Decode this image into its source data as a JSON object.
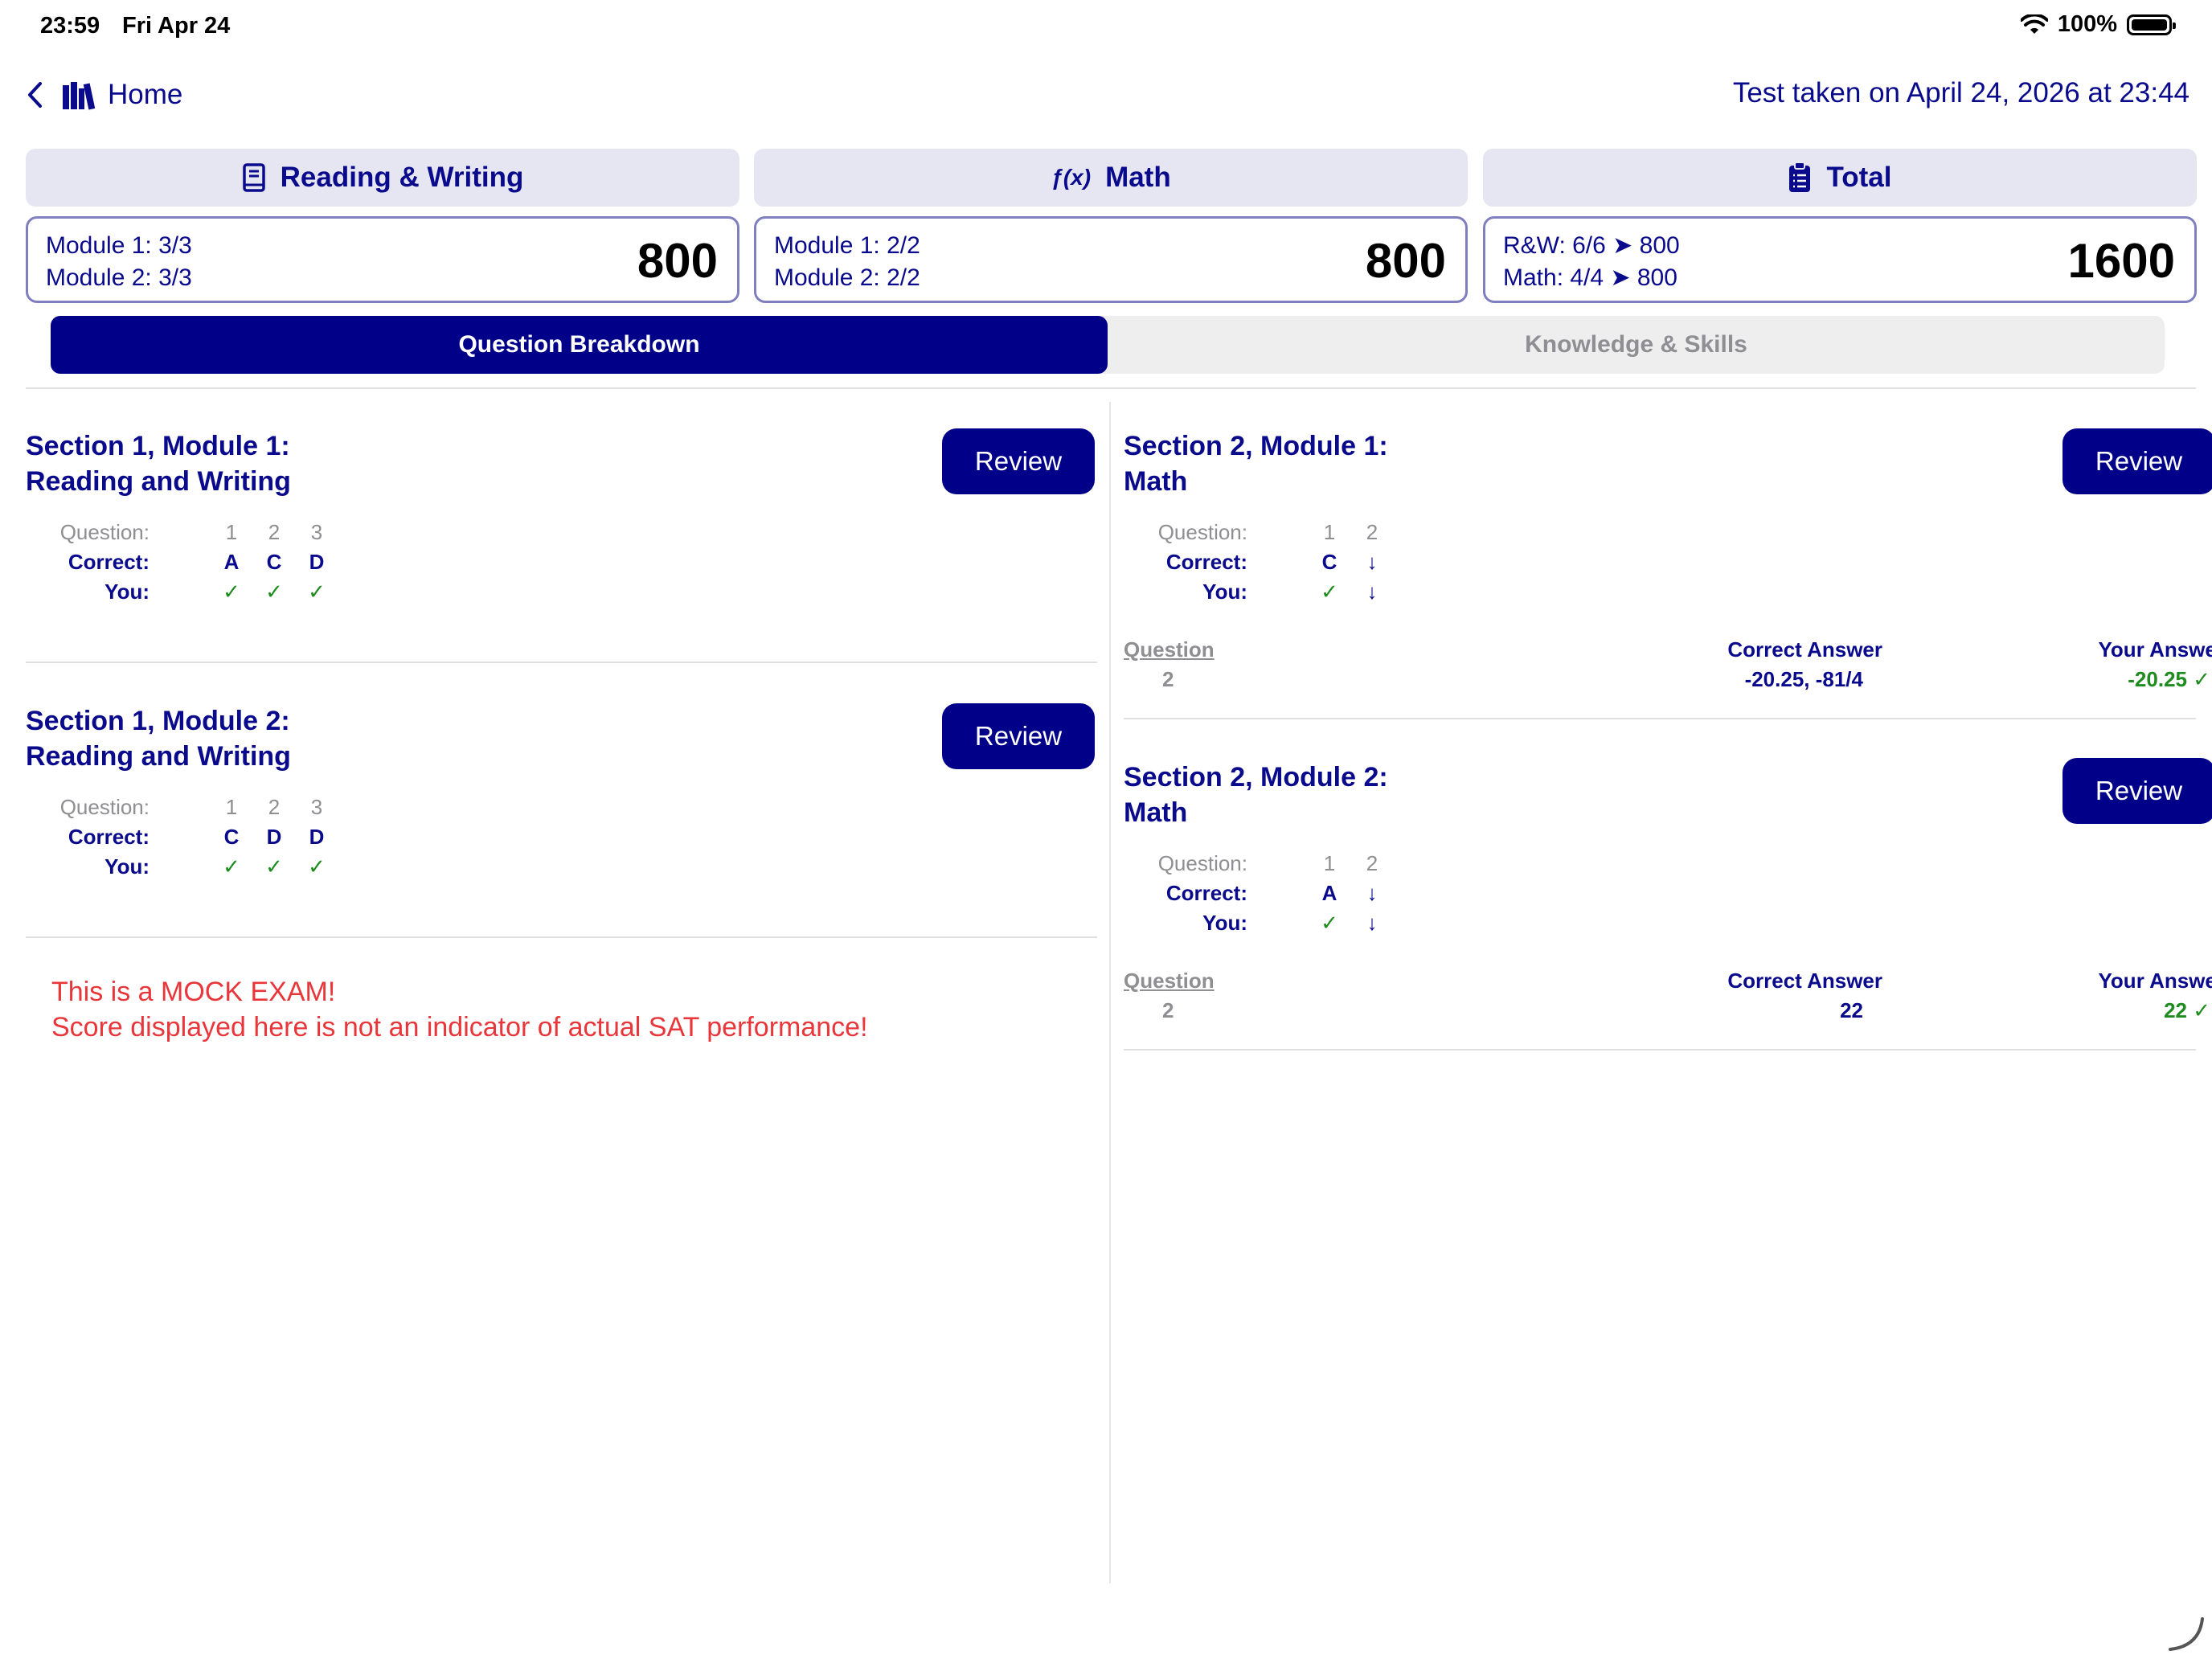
{
  "status": {
    "time": "23:59",
    "date": "Fri Apr 24",
    "battery": "100%"
  },
  "nav": {
    "home_label": "Home",
    "test_taken": "Test taken on April 24, 2026 at 23:44"
  },
  "scores": {
    "rw": {
      "title": "Reading & Writing",
      "line1": "Module 1: 3/3",
      "line2": "Module 2: 3/3",
      "score": "800",
      "icon": "book-icon"
    },
    "math": {
      "title": "Math",
      "icon_text": "ƒ(x)",
      "line1": "Module 1: 2/2",
      "line2": "Module 2: 2/2",
      "score": "800"
    },
    "total": {
      "title": "Total",
      "line1": "R&W: 6/6 ➤ 800",
      "line2": "Math: 4/4 ➤ 800",
      "score": "1600",
      "icon": "clipboard-icon"
    }
  },
  "tabs": {
    "active": "Question Breakdown",
    "inactive": "Knowledge & Skills"
  },
  "labels": {
    "question": "Question:",
    "correct": "Correct:",
    "you": "You:",
    "review": "Review",
    "col_question": "Question",
    "col_correct": "Correct Answer",
    "col_your": "Your Answer"
  },
  "modules": {
    "rw1": {
      "title1": "Section 1, Module 1:",
      "title2": "Reading and Writing",
      "questions": [
        "1",
        "2",
        "3"
      ],
      "correct": [
        "A",
        "C",
        "D"
      ],
      "you": [
        "✓",
        "✓",
        "✓"
      ]
    },
    "rw2": {
      "title1": "Section 1, Module 2:",
      "title2": "Reading and Writing",
      "questions": [
        "1",
        "2",
        "3"
      ],
      "correct": [
        "C",
        "D",
        "D"
      ],
      "you": [
        "✓",
        "✓",
        "✓"
      ]
    },
    "m1": {
      "title1": "Section 2, Module 1:",
      "title2": "Math",
      "questions": [
        "1",
        "2"
      ],
      "correct": [
        "C",
        "↓"
      ],
      "you": [
        "✓",
        "↓"
      ],
      "detail": {
        "question": "2",
        "correct": "-20.25, -81/4",
        "your": "-20.25 ✓"
      }
    },
    "m2": {
      "title1": "Section 2, Module 2:",
      "title2": "Math",
      "questions": [
        "1",
        "2"
      ],
      "correct": [
        "A",
        "↓"
      ],
      "you": [
        "✓",
        "↓"
      ],
      "detail": {
        "question": "2",
        "correct": "22",
        "your": "22 ✓"
      }
    }
  },
  "mock_notice": {
    "line1": "This is a MOCK EXAM!",
    "line2": "Score displayed here is not an indicator of actual SAT performance!"
  },
  "colors": {
    "navy": "#0a0a8c",
    "button": "#000088",
    "green": "#1e8c1e",
    "warning": "#e8363a"
  }
}
